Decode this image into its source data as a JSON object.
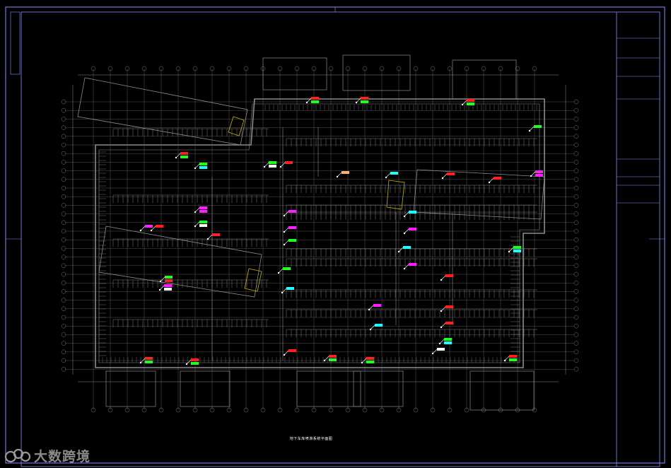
{
  "drawing": {
    "title": "地下车库喷淋系统平面图",
    "colors": {
      "background": "#000000",
      "frame": "#8c8cff",
      "wall": "#8c8c8c",
      "grid": "#7a7a7a",
      "sprinkler_red": "#ff2020",
      "sprinkler_green": "#20ff20",
      "sprinkler_magenta": "#ff20ff",
      "sprinkler_cyan": "#20ffff",
      "sprinkler_white": "#ffffff",
      "accent_yellow": "#c8b400",
      "accent_orange": "#ffb070"
    }
  },
  "title_block": {
    "rows": [
      "",
      "",
      "",
      "",
      "",
      "",
      ""
    ]
  },
  "watermark": {
    "logo_icon": "dashu-logo-icon",
    "text": "大数跨境"
  }
}
